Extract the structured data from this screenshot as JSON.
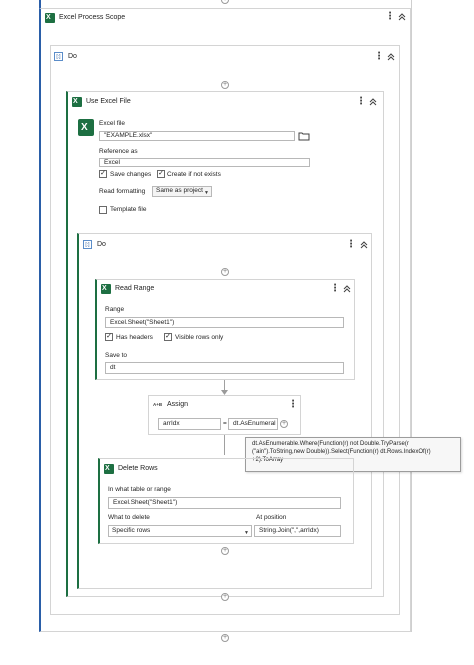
{
  "outer_scope": {
    "title": "Excel Process Scope"
  },
  "do_outer": {
    "title": "Do"
  },
  "use_excel": {
    "title": "Use Excel File",
    "excel_file_label": "Excel file",
    "excel_file_value": "\"EXAMPLE.xlsx\"",
    "reference_as_label": "Reference as",
    "reference_as_value": "Excel",
    "save_changes_label": "Save changes",
    "create_if_not_exists_label": "Create if not exists",
    "read_formatting_label": "Read formatting",
    "read_formatting_value": "Same as project",
    "template_file_label": "Template file"
  },
  "do_inner": {
    "title": "Do"
  },
  "read_range": {
    "title": "Read Range",
    "range_label": "Range",
    "range_value": "Excel.Sheet(\"Sheet1\")",
    "has_headers_label": "Has headers",
    "visible_rows_label": "Visible rows only",
    "save_to_label": "Save to",
    "save_to_value": "dt"
  },
  "assign": {
    "icon_text": "A+B",
    "title": "Assign",
    "left_value": "arrIdx",
    "equals": "=",
    "right_value": "dt.AsEnumeral"
  },
  "tooltip": {
    "line1": "dt.AsEnumerable.Where(Function(r) not Double.TryParse(r",
    "line2": "(\"ain\").ToString,new Double)).Select(Function(r) dt.Rows.IndexOf(r)",
    "line3": "+2).ToArray"
  },
  "delete_rows": {
    "title": "Delete Rows",
    "table_label": "In what table or range",
    "table_value": "Excel.Sheet(\"Sheet1\")",
    "what_to_delete_label": "What to delete",
    "what_to_delete_value": "Specific rows",
    "at_position_label": "At position",
    "at_position_value": "String.Join(\",\",arrIdx)"
  },
  "icons": {
    "kebab": "⋮",
    "collapse": "⌃",
    "plus": "+",
    "check": "✓",
    "caret": "▼",
    "seq": "[:]"
  }
}
